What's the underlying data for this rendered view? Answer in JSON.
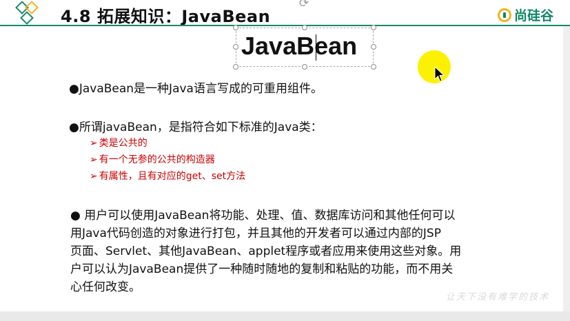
{
  "header": {
    "title": "4.8  拓展知识：JavaBean",
    "brand_text": "尚硅谷"
  },
  "selected_title": {
    "text": "JavaBean"
  },
  "bullets": [
    {
      "text": "●JavaBean是一种Java语言写成的可重用组件。"
    },
    {
      "text": "●所谓javaBean，是指符合如下标准的Java类：",
      "sub_items": [
        "类是公共的",
        "有一个无参的公共的构造器",
        "有属性，且有对应的get、set方法"
      ]
    }
  ],
  "paragraph": {
    "lines": [
      "●  用户可以使用JavaBean将功能、处理、值、数据库访问和其他任何可以",
      "用Java代码创造的对象进行打包，并且其他的开发者可以通过内部的JSP",
      "页面、Servlet、其他JavaBean、applet程序或者应用来使用这些对象。用",
      "户可以认为JavaBean提供了一种随时随地的复制和粘贴的功能，而不用关",
      "心任何改变。"
    ]
  },
  "footer": {
    "slogan": "让天下没有难学的技术"
  },
  "colors": {
    "header_line": "#13896b",
    "brand_green": "#12856a",
    "brand_gold": "#f6b21a",
    "sub_item_red": "#cc0000",
    "pointer_highlight": "#fbf100"
  },
  "icons": {
    "logo": "diamond-logo-icon",
    "rotate": "rotate-handle-icon",
    "cursor": "mouse-pointer-icon",
    "sub_bullet": "arrow-bullet-icon"
  }
}
